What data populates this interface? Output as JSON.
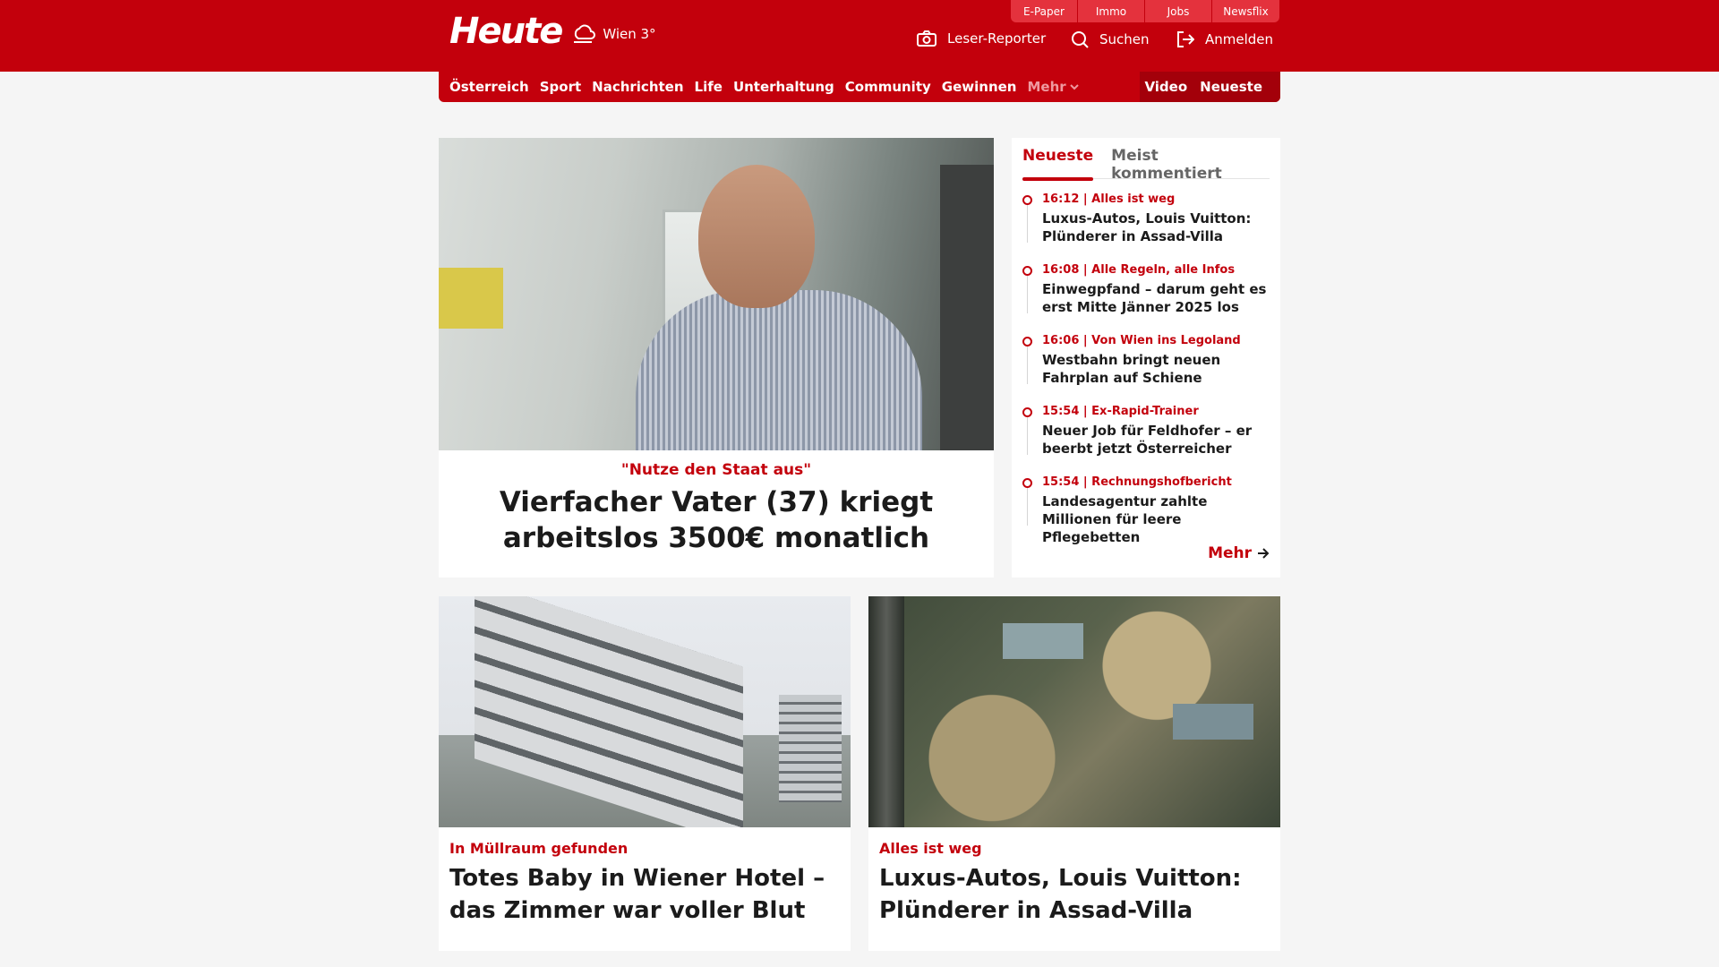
{
  "header": {
    "logo": "Heute",
    "weather": "Wien 3°",
    "service_tabs": [
      "E-Paper",
      "Immo",
      "Jobs",
      "Newsflix"
    ],
    "reporter_label": "Leser-Reporter",
    "search_label": "Suchen",
    "login_label": "Anmelden"
  },
  "nav": {
    "items": [
      "Österreich",
      "Sport",
      "Nachrichten",
      "Life",
      "Unterhaltung",
      "Community",
      "Gewinnen"
    ],
    "more_label": "Mehr",
    "right": [
      "Video",
      "Neueste"
    ]
  },
  "hero": {
    "kicker": "\"Nutze den Staat aus\"",
    "title": "Vierfacher Vater (37) kriegt arbeitslos 3500€ monatlich"
  },
  "sidebar": {
    "tabs": [
      "Neueste",
      "Meist kommentiert"
    ],
    "items": [
      {
        "meta": "16:12 | Alles ist weg",
        "title": "Luxus-Autos, Louis Vuitton: Plünderer in Assad-Villa"
      },
      {
        "meta": "16:08 | Alle Regeln, alle Infos",
        "title": "Einwegpfand – darum geht es erst Mitte Jänner 2025 los"
      },
      {
        "meta": "16:06 | Von Wien ins Legoland",
        "title": "Westbahn bringt neuen Fahrplan auf Schiene"
      },
      {
        "meta": "15:54 | Ex-Rapid-Trainer",
        "title": "Neuer Job für Feldhofer – er beerbt jetzt Österreicher"
      },
      {
        "meta": "15:54 | Rechnungshofbericht",
        "title": "Landesagentur zahlte Millionen für leere Pflegebetten"
      }
    ],
    "more_label": "Mehr"
  },
  "cards": [
    {
      "kicker": "In Müllraum gefunden",
      "title": "Totes Baby in Wiener Hotel – das Zimmer war voller Blut"
    },
    {
      "kicker": "Alles ist weg",
      "title": "Luxus-Autos, Louis Vuitton: Plünderer in Assad-Villa"
    }
  ],
  "colors": {
    "brand": "#c3000c",
    "background": "#f5f5f5"
  }
}
